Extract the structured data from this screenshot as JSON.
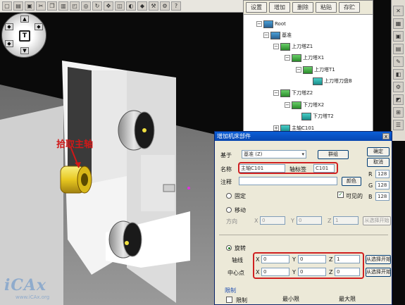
{
  "tree_panel": {
    "buttons": [
      "设置",
      "增加",
      "删除",
      "粘贴",
      "存贮"
    ],
    "nodes": [
      {
        "label": "Root",
        "icon": "root-icon"
      },
      {
        "label": "基准",
        "icon": "base-icon"
      },
      {
        "label": "上刀塔Z1",
        "icon": "turret-icon"
      },
      {
        "label": "上刀塔X1",
        "icon": "turret-icon"
      },
      {
        "label": "上刀塔T1",
        "icon": "turret-icon"
      },
      {
        "label": "上刀塔刀盘B",
        "icon": "tool-disc-icon"
      },
      {
        "label": "下刀塔Z2",
        "icon": "turret-icon"
      },
      {
        "label": "下刀塔X2",
        "icon": "turret-icon"
      },
      {
        "label": "下刀塔T2",
        "icon": "tool-disc-icon"
      },
      {
        "label": "主轴C101",
        "icon": "spindle-icon"
      }
    ]
  },
  "annotation": "拾取主轴",
  "watermark": {
    "main": "iCAx",
    "sub": "www.iCAx.org"
  },
  "dialog": {
    "title": "增加机床部件",
    "close": "x",
    "base_label": "基于",
    "base_value": "基准 (Z)",
    "group_button": "群组",
    "ok_button": "确定",
    "cancel_button": "取消",
    "name_label": "名称",
    "name_value": "主轴C101",
    "axis_label": "轴标签",
    "axis_value": "C101",
    "note_label": "注释",
    "color_button": "颜色",
    "visible_label": "可见的",
    "rgb": [
      {
        "label": "R",
        "value": "128"
      },
      {
        "label": "G",
        "value": "128"
      },
      {
        "label": "B",
        "value": "128"
      }
    ],
    "fixed_label": "固定",
    "move_label": "移动",
    "direction_label": "方向",
    "move_inputs": [
      "0",
      "0",
      "1"
    ],
    "pick_move_button": "从选择开始",
    "rotate_label": "旋转",
    "axis_line_label": "轴线",
    "axis_line_values": [
      "0",
      "0",
      "1"
    ],
    "center_label": "中心点",
    "center_values": [
      "0",
      "0",
      "0"
    ],
    "pick_axis_button": "从选择开始",
    "pick_center_button": "从选择开始",
    "limits_label": "限制",
    "limit_check_label": "限制",
    "min_label": "最小限",
    "max_label": "最大限",
    "xyz": [
      "X",
      "Y",
      "Z"
    ]
  }
}
